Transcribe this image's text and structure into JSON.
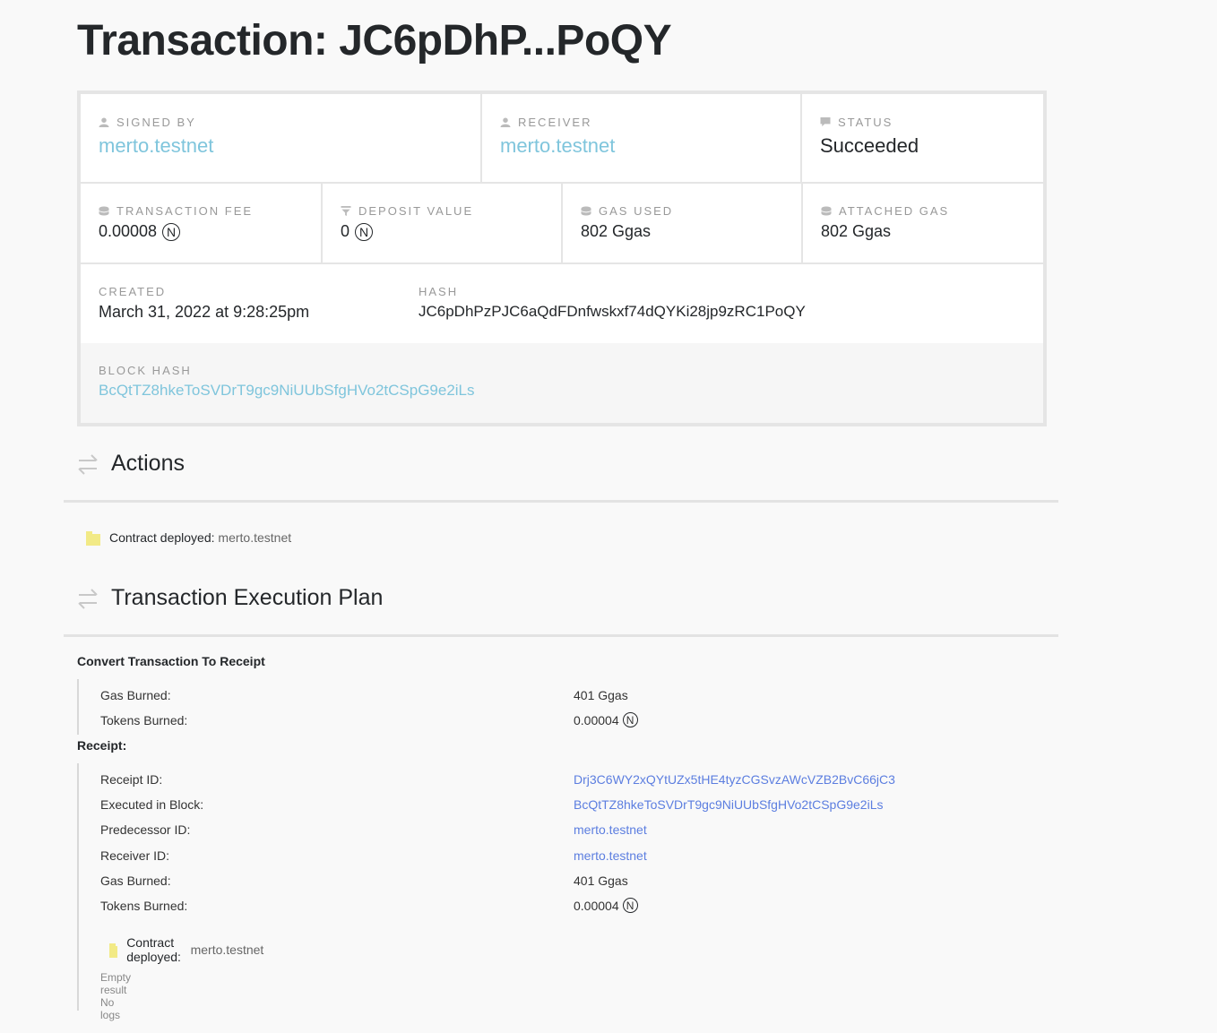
{
  "page": {
    "title": "Transaction: JC6pDhP...PoQY"
  },
  "card": {
    "signed_by": {
      "label": "Signed by",
      "value": "merto.testnet"
    },
    "receiver": {
      "label": "Receiver",
      "value": "merto.testnet"
    },
    "status": {
      "label": "Status",
      "value": "Succeeded"
    },
    "transaction_fee": {
      "label": "Transaction Fee",
      "value": "0.00008",
      "unit": "N"
    },
    "deposit_value": {
      "label": "Deposit Value",
      "value": "0",
      "unit": "N"
    },
    "gas_used": {
      "label": "Gas Used",
      "value": "802 Ggas"
    },
    "attached_gas": {
      "label": "Attached Gas",
      "value": "802 Ggas"
    },
    "created": {
      "label": "Created",
      "value": "March 31, 2022 at 9:28:25pm"
    },
    "hash": {
      "label": "Hash",
      "value": "JC6pDhPzPJC6aQdFDnfwskxf74dQYKi28jp9zRC1PoQY"
    },
    "block_hash": {
      "label": "Block Hash",
      "value": "BcQtTZ8hkeToSVDrT9gc9NiUUbSfgHVo2tCSpG9e2iLs"
    }
  },
  "actions": {
    "title": "Actions",
    "items": [
      {
        "label": "Contract deployed:",
        "value": "merto.testnet"
      }
    ]
  },
  "execution_plan": {
    "title": "Transaction Execution Plan",
    "convert": {
      "heading": "Convert Transaction To Receipt",
      "gas_burned_label": "Gas Burned:",
      "gas_burned_value": "401 Ggas",
      "tokens_burned_label": "Tokens Burned:",
      "tokens_burned_value": "0.00004",
      "unit": "N"
    },
    "receipt": {
      "heading": "Receipt:",
      "receipt_id_label": "Receipt ID:",
      "receipt_id_value": "Drj3C6WY2xQYtUZx5tHE4tyzCGSvzAWcVZB2BvC66jC3",
      "executed_in_block_label": "Executed in Block:",
      "executed_in_block_value": "BcQtTZ8hkeToSVDrT9gc9NiUUbSfgHVo2tCSpG9e2iLs",
      "predecessor_label": "Predecessor ID:",
      "predecessor_value": "merto.testnet",
      "receiver_label": "Receiver ID:",
      "receiver_value": "merto.testnet",
      "gas_burned_label": "Gas Burned:",
      "gas_burned_value": "401 Ggas",
      "tokens_burned_label": "Tokens Burned:",
      "tokens_burned_value": "0.00004",
      "unit": "N",
      "action_label": "Contract deployed:",
      "action_value": "merto.testnet",
      "result": "Empty result",
      "logs": "No logs"
    }
  },
  "colors": {
    "link_light": "#7fc5dc",
    "link_blue": "#5c7ee0",
    "folder": "#f2ea86",
    "border": "#e5e5e5"
  },
  "icons": {
    "signed_by": "user-icon",
    "receiver": "user-icon",
    "status": "flag-icon",
    "fee": "coins-icon",
    "deposit": "filter-icon",
    "gas": "coins-icon",
    "actions": "transfer-arrows-icon",
    "action_item": "folder-icon"
  }
}
